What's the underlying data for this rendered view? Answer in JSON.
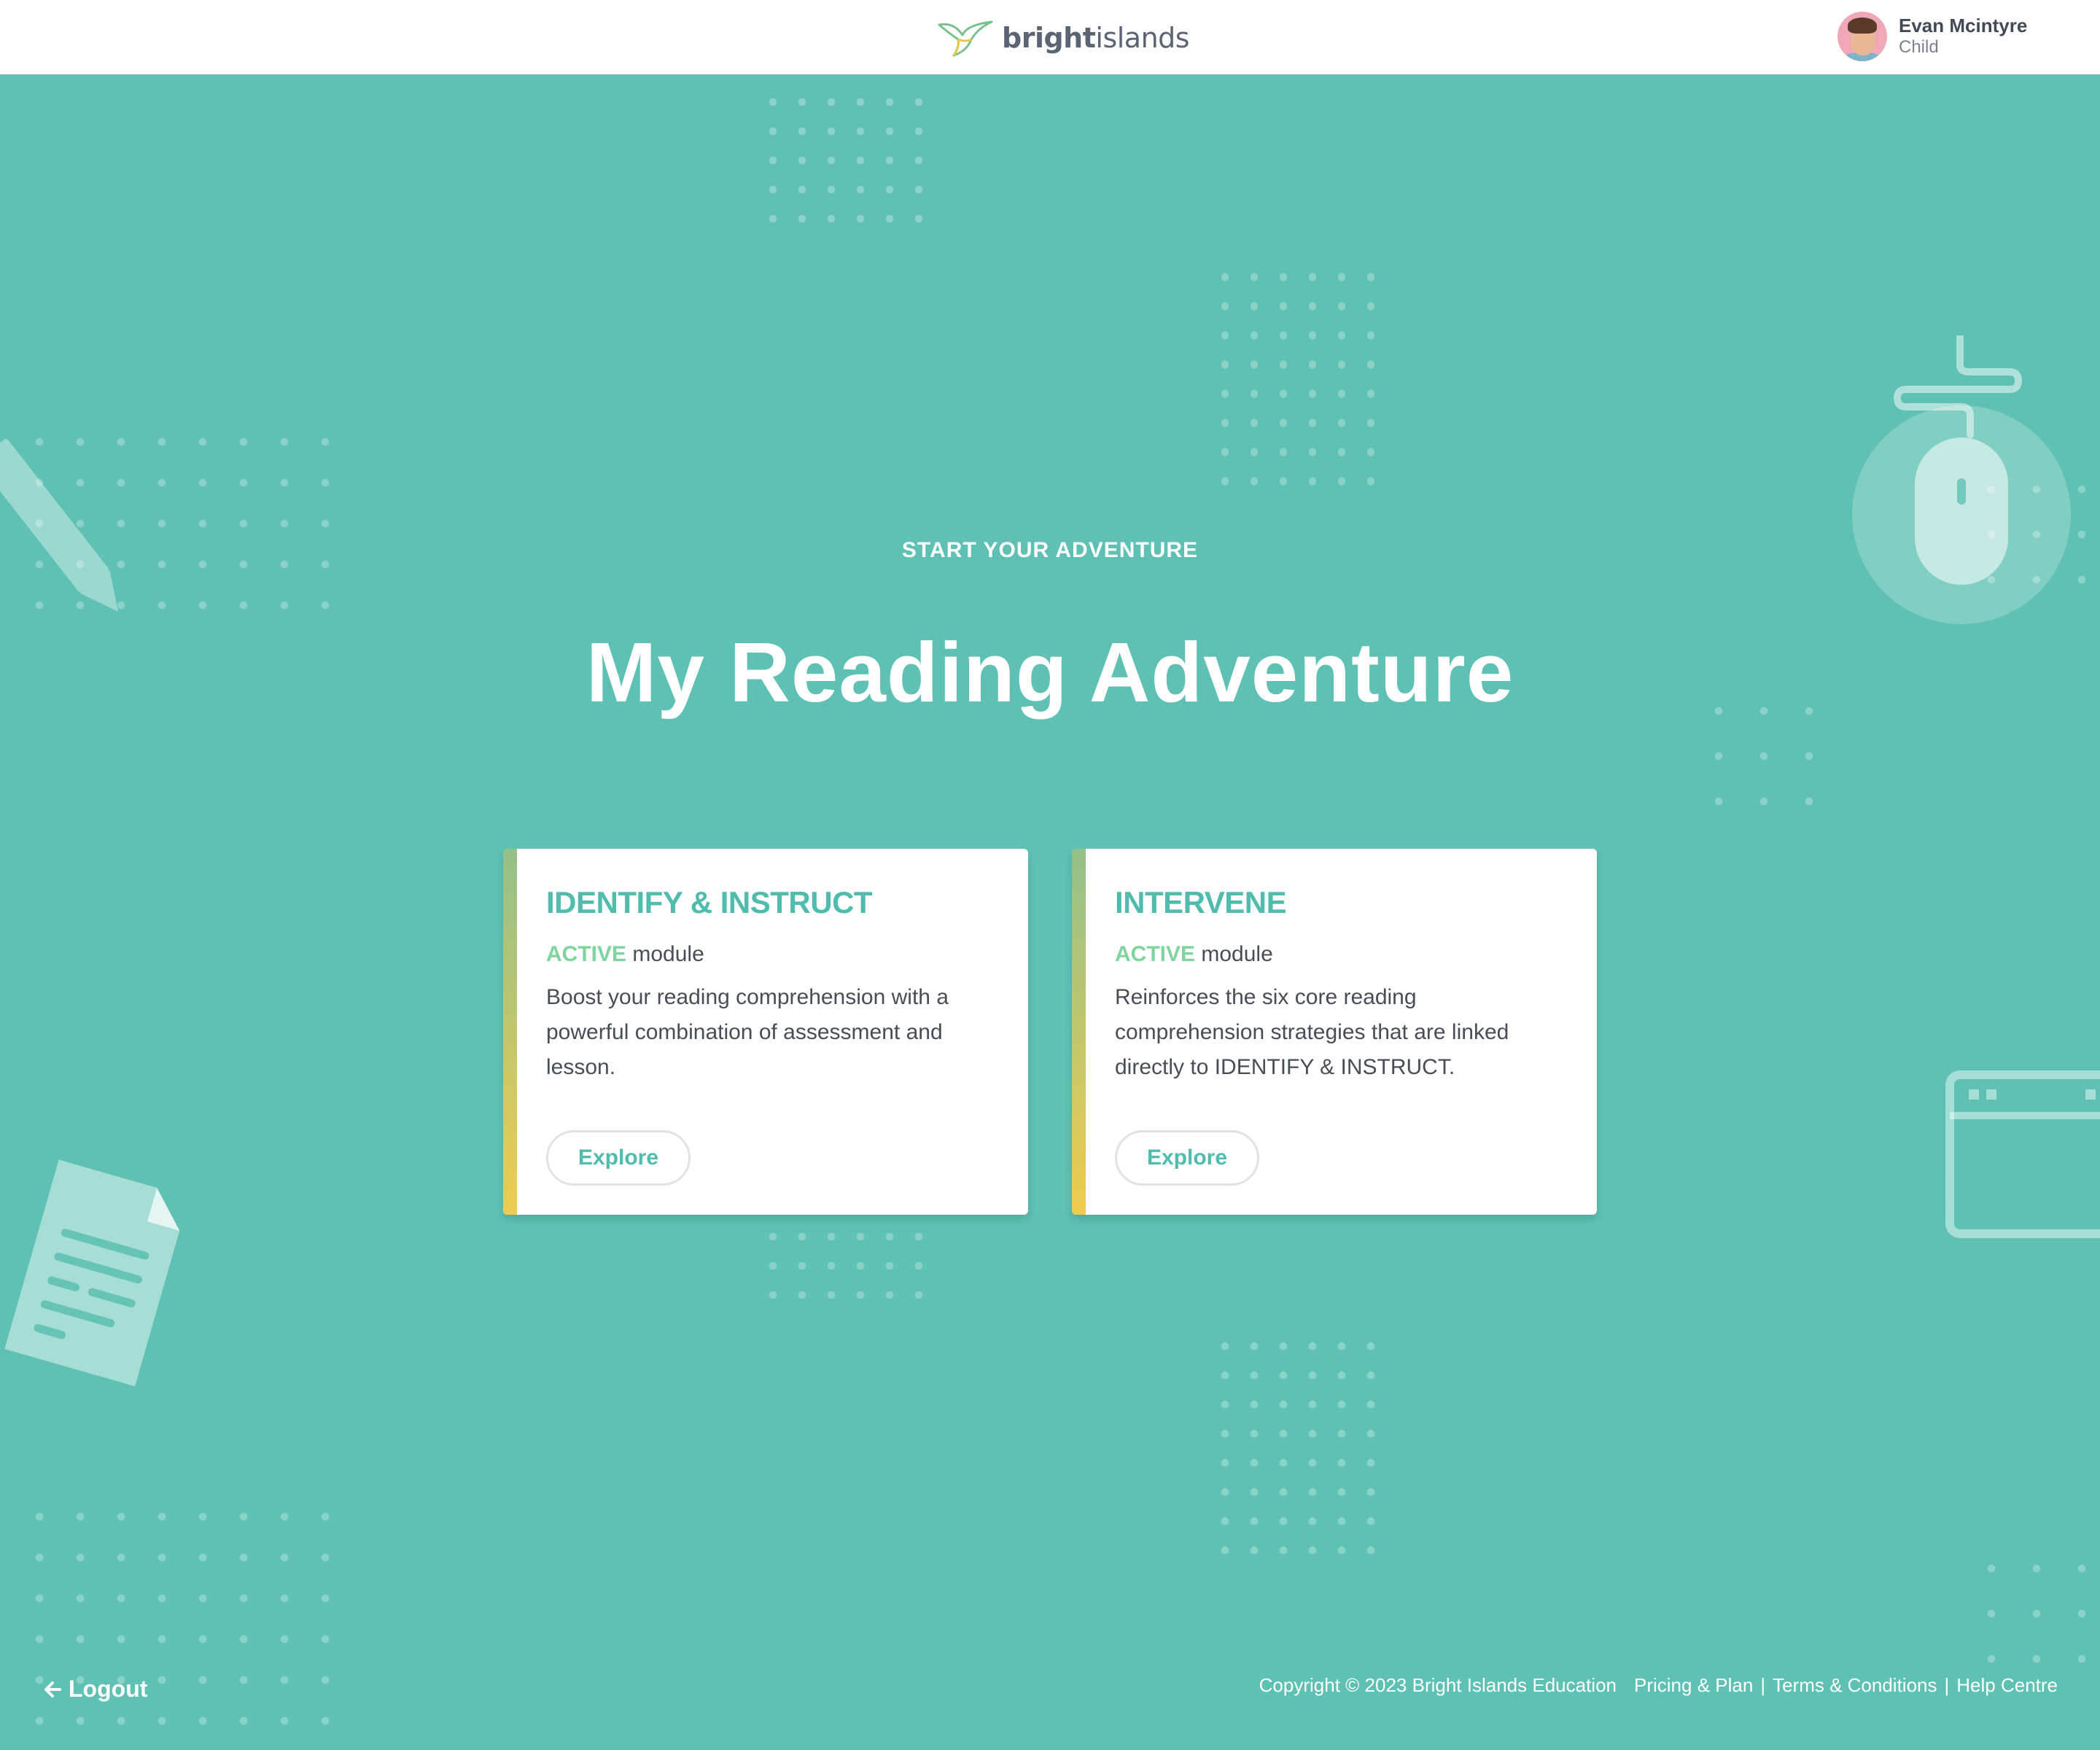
{
  "brand": {
    "bold": "bright",
    "light": "islands"
  },
  "user": {
    "name": "Evan Mcintyre",
    "role": "Child"
  },
  "hero": {
    "kicker": "START YOUR ADVENTURE",
    "title": "My Reading Adventure"
  },
  "cards": [
    {
      "title": "IDENTIFY & INSTRUCT",
      "status": "ACTIVE",
      "status_suffix": "module",
      "description": "Boost your reading comprehension with a powerful combination of assessment and lesson.",
      "button": "Explore"
    },
    {
      "title": "INTERVENE",
      "status": "ACTIVE",
      "status_suffix": "module",
      "description": "Reinforces the six core reading comprehension strategies that are linked directly to IDENTIFY & INSTRUCT.",
      "button": "Explore"
    }
  ],
  "footer": {
    "logout": "Logout",
    "copyright": "Copyright © 2023 Bright Islands Education",
    "links": [
      "Pricing & Plan",
      "Terms & Conditions",
      "Help Centre"
    ],
    "separator": "|"
  },
  "colors": {
    "background": "#5ec1b3",
    "accent": "#4fbcae",
    "active": "#7fd4a0",
    "text": "#474e57"
  },
  "icons": [
    "hummingbird-logo-icon",
    "pencil-icon",
    "mouse-icon",
    "document-icon",
    "browser-window-icon",
    "arrow-left-icon"
  ]
}
